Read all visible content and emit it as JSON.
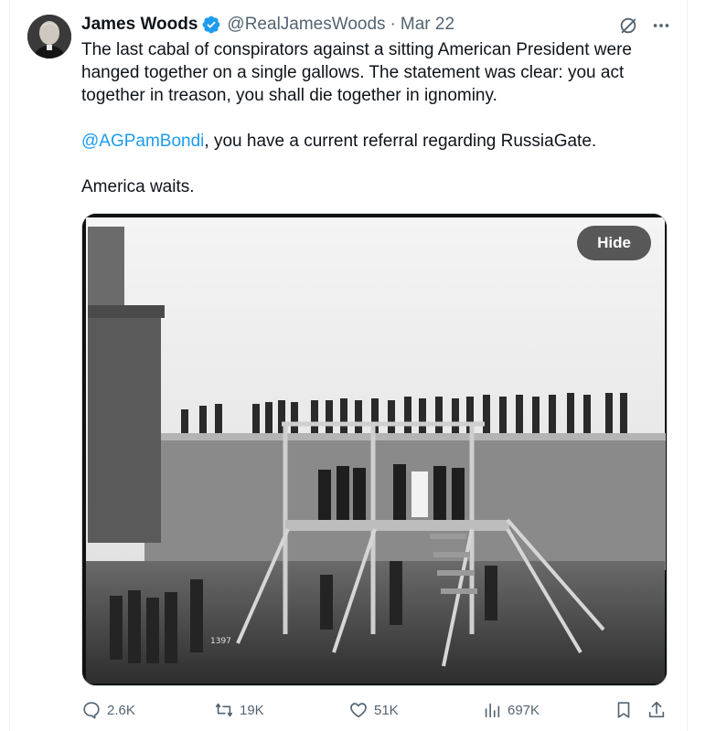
{
  "author": {
    "display_name": "James Woods",
    "handle": "@RealJamesWoods",
    "separator": "·",
    "date": "Mar 22"
  },
  "icons": {
    "verified": "verified-badge-icon",
    "grok": "grok-icon",
    "more": "more-icon",
    "reply": "reply-icon",
    "retweet": "retweet-icon",
    "like": "like-icon",
    "views": "views-icon",
    "bookmark": "bookmark-icon",
    "share": "share-icon"
  },
  "tweet": {
    "paragraph1": "The last cabal of conspirators against a sitting American President were hanged together on a single gallows. The statement was clear: you act together in treason, you shall die together in ignominy.",
    "mention": "@AGPamBondi",
    "paragraph2_rest": ", you have a current referral regarding RussiaGate.",
    "paragraph3": "America waits."
  },
  "media": {
    "hide_label": "Hide",
    "photo_number": "1397"
  },
  "actions": {
    "replies": "2.6K",
    "retweets": "19K",
    "likes": "51K",
    "views": "697K"
  },
  "colors": {
    "accent": "#1d9bf0",
    "secondary_text": "#536471",
    "text": "#0f1419"
  }
}
